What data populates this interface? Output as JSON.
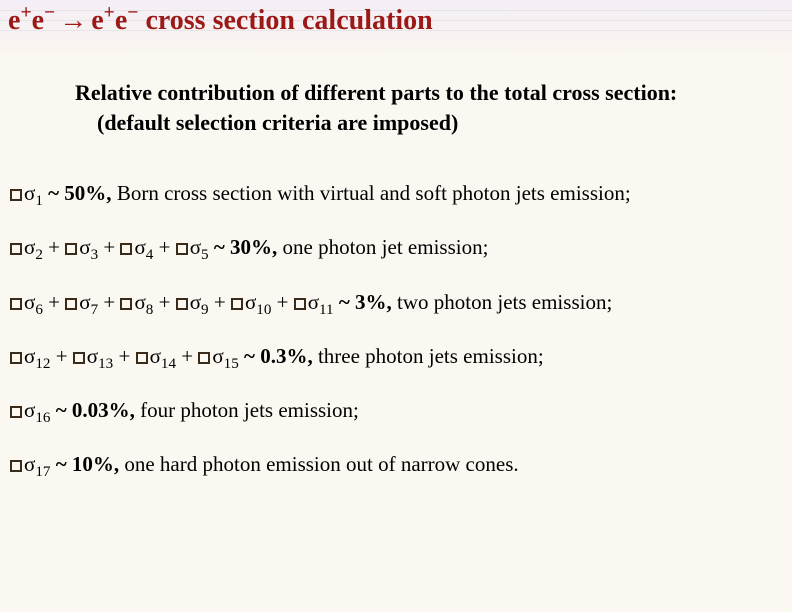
{
  "title": {
    "lhs": "e⁺e⁻",
    "arrow": "→",
    "rhs": "e⁺e⁻",
    "tail": "cross section calculation",
    "color": "#9b1a18"
  },
  "intro": {
    "line1": "Relative contribution of different parts to the total cross section:",
    "line2": "(default selection criteria are imposed)"
  },
  "sigma_glyph": "σ",
  "items": [
    {
      "terms": [
        1
      ],
      "pct": "~ 50%,",
      "desc": "Born cross section with virtual and soft photon jets emission;"
    },
    {
      "terms": [
        2,
        3,
        4,
        5
      ],
      "pct": "~  30%,",
      "desc": "one photon jet emission;"
    },
    {
      "terms": [
        6,
        7,
        8,
        9,
        10,
        11
      ],
      "pct": "~ 3%,",
      "desc": "two photon jets emission;"
    },
    {
      "terms": [
        12,
        13,
        14,
        15
      ],
      "pct": "~ 0.3%,",
      "desc": "three photon jets emission;"
    },
    {
      "terms": [
        16
      ],
      "pct": "~ 0.03%,",
      "desc": "four photon jets emission;"
    },
    {
      "terms": [
        17
      ],
      "pct": "~ 10%,",
      "desc": "one hard photon emission out of narrow cones."
    }
  ]
}
